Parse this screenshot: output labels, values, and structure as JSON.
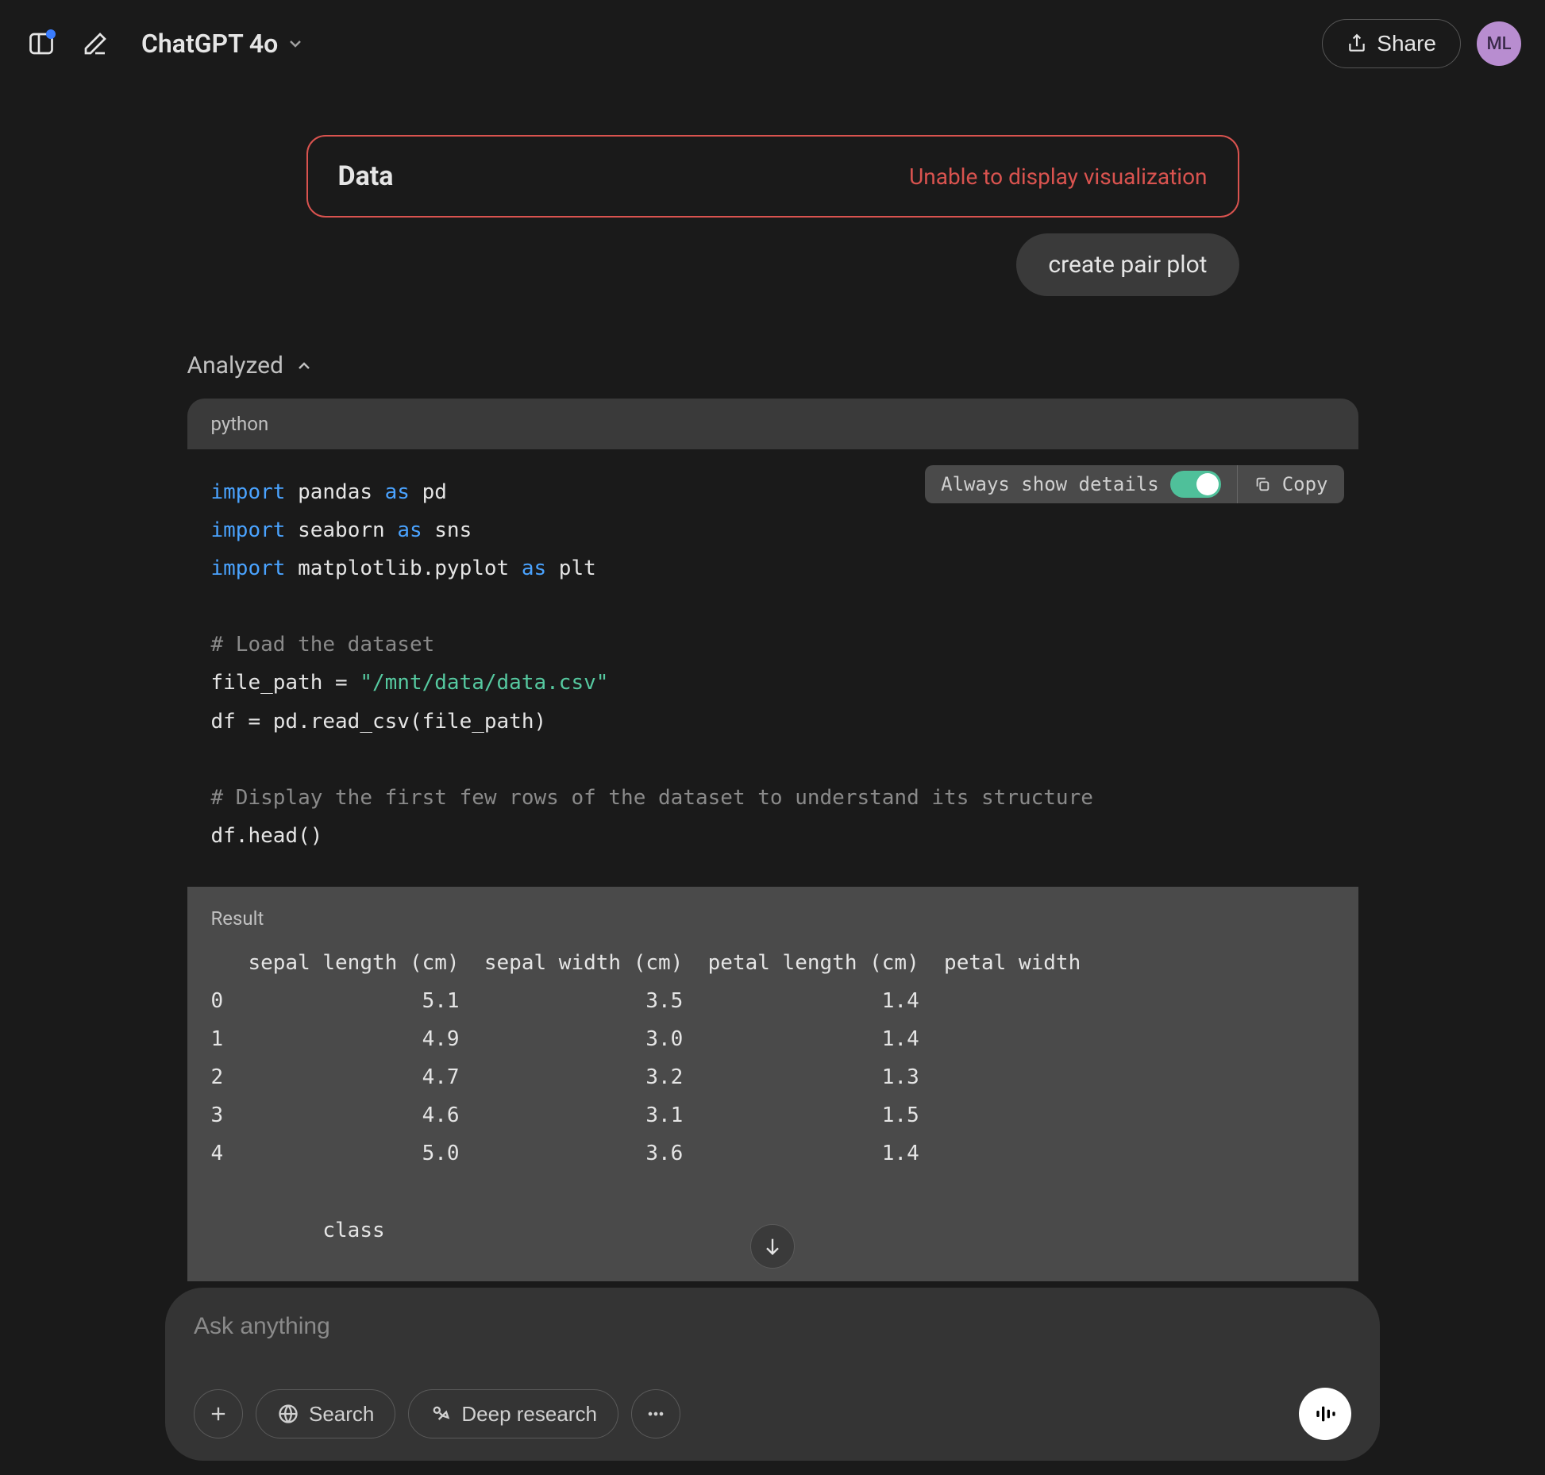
{
  "header": {
    "model": "ChatGPT 4o",
    "share_label": "Share",
    "avatar_initials": "ML"
  },
  "data_card": {
    "title": "Data",
    "error": "Unable to display visualization"
  },
  "user_message": "create pair plot",
  "analyzed": {
    "label": "Analyzed"
  },
  "code": {
    "language": "python",
    "toolbar": {
      "always_show_label": "Always show details",
      "copy_label": "Copy"
    },
    "lines": {
      "l1_kw": "import",
      "l1_mod": " pandas ",
      "l1_as": "as",
      "l1_al": " pd",
      "l2_kw": "import",
      "l2_mod": " seaborn ",
      "l2_as": "as",
      "l2_al": " sns",
      "l3_kw": "import",
      "l3_mod": " matplotlib.pyplot ",
      "l3_as": "as",
      "l3_al": " plt",
      "c1": "# Load the dataset",
      "l4a": "file_path = ",
      "l4b": "\"/mnt/data/data.csv\"",
      "l5": "df = pd.read_csv(file_path)",
      "c2": "# Display the first few rows of the dataset to understand its structure",
      "l6": "df.head()"
    }
  },
  "result": {
    "label": "Result",
    "text": "   sepal length (cm)  sepal width (cm)  petal length (cm)  petal width\n0                5.1               3.5                1.4\n1                4.9               3.0                1.4\n2                4.7               3.2                1.3\n3                4.6               3.1                1.5\n4                5.0               3.6                1.4\n\n         class"
  },
  "composer": {
    "placeholder": "Ask anything",
    "search_label": "Search",
    "deep_research_label": "Deep research"
  }
}
